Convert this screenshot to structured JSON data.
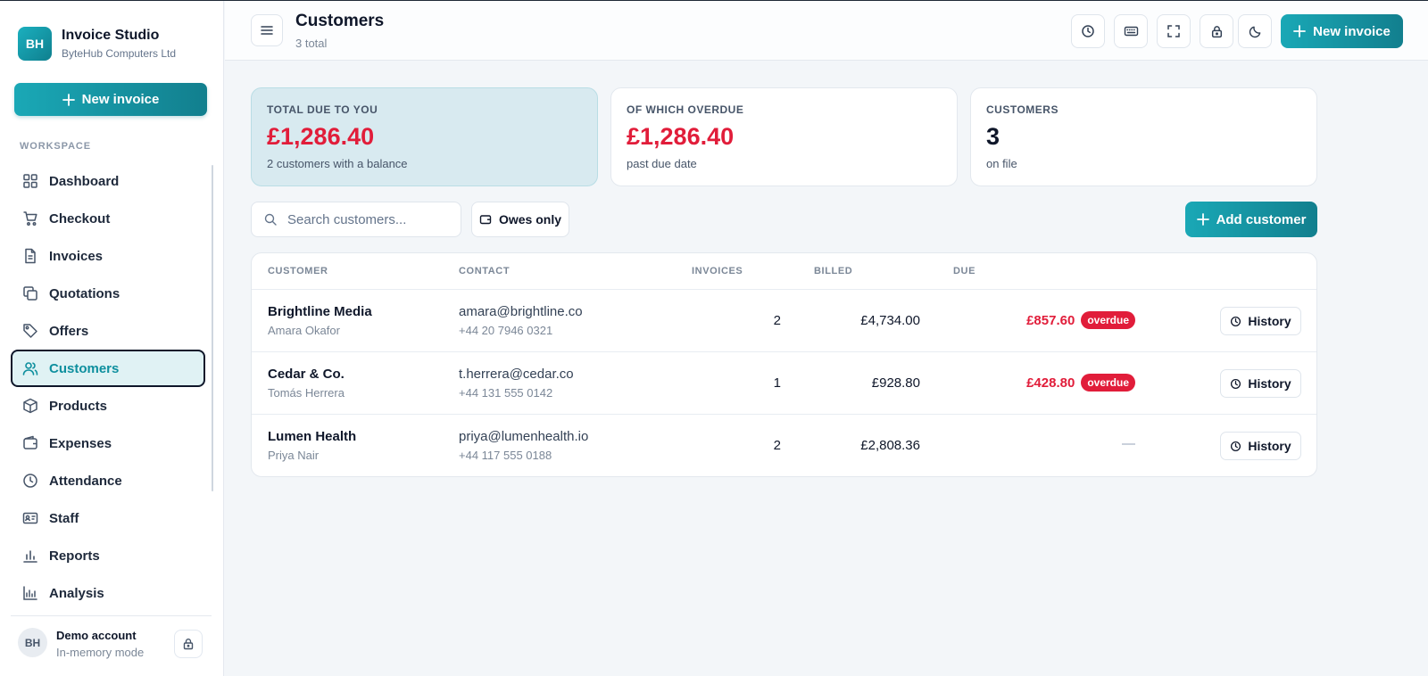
{
  "brand": {
    "initials": "BH",
    "name": "Invoice Studio",
    "company": "ByteHub Computers Ltd"
  },
  "sidebar": {
    "new_invoice_label": "New invoice",
    "section_label": "WORKSPACE",
    "items": [
      {
        "label": "Dashboard",
        "icon": "grid-icon"
      },
      {
        "label": "Checkout",
        "icon": "cart-icon"
      },
      {
        "label": "Invoices",
        "icon": "document-icon"
      },
      {
        "label": "Quotations",
        "icon": "copy-icon"
      },
      {
        "label": "Offers",
        "icon": "tag-icon"
      },
      {
        "label": "Customers",
        "icon": "users-icon",
        "active": true
      },
      {
        "label": "Products",
        "icon": "box-icon"
      },
      {
        "label": "Expenses",
        "icon": "wallet-icon"
      },
      {
        "label": "Attendance",
        "icon": "clock-icon"
      },
      {
        "label": "Staff",
        "icon": "id-card-icon"
      },
      {
        "label": "Reports",
        "icon": "bar-chart-icon"
      },
      {
        "label": "Analysis",
        "icon": "analysis-chart-icon"
      }
    ],
    "account": {
      "initials": "BH",
      "name": "Demo account",
      "mode": "In-memory mode"
    }
  },
  "header": {
    "title": "Customers",
    "subtitle": "3 total",
    "new_invoice_label": "New invoice",
    "icons": [
      "history-icon",
      "keyboard-icon",
      "fullscreen-icon",
      "lock-icon",
      "moon-icon"
    ]
  },
  "stats": [
    {
      "label": "TOTAL DUE TO YOU",
      "value": "£1,286.40",
      "note": "2 customers with a balance"
    },
    {
      "label": "OF WHICH OVERDUE",
      "value": "£1,286.40",
      "note": "past due date"
    },
    {
      "label": "CUSTOMERS",
      "value": "3",
      "note": "on file"
    }
  ],
  "toolbar": {
    "search_placeholder": "Search customers...",
    "owes_only_label": "Owes only",
    "add_customer_label": "Add customer"
  },
  "table": {
    "columns": [
      "CUSTOMER",
      "CONTACT",
      "INVOICES",
      "BILLED",
      "DUE"
    ],
    "rows": [
      {
        "name": "Brightline Media",
        "person": "Amara Okafor",
        "email": "amara@brightline.co",
        "phone": "+44 20 7946 0321",
        "invoices": "2",
        "billed": "£4,734.00",
        "due": "£857.60",
        "status": "overdue",
        "action": "History"
      },
      {
        "name": "Cedar & Co.",
        "person": "Tomás Herrera",
        "email": "t.herrera@cedar.co",
        "phone": "+44 131 555 0142",
        "invoices": "1",
        "billed": "£928.80",
        "due": "£428.80",
        "status": "overdue",
        "action": "History"
      },
      {
        "name": "Lumen Health",
        "person": "Priya Nair",
        "email": "priya@lumenhealth.io",
        "phone": "+44 117 555 0188",
        "invoices": "2",
        "billed": "£2,808.36",
        "due": "—",
        "status": "",
        "action": "History"
      }
    ]
  },
  "colors": {
    "accent": "#1aa8b6",
    "accent_dark": "#127f8e",
    "danger": "#e11d3a"
  }
}
